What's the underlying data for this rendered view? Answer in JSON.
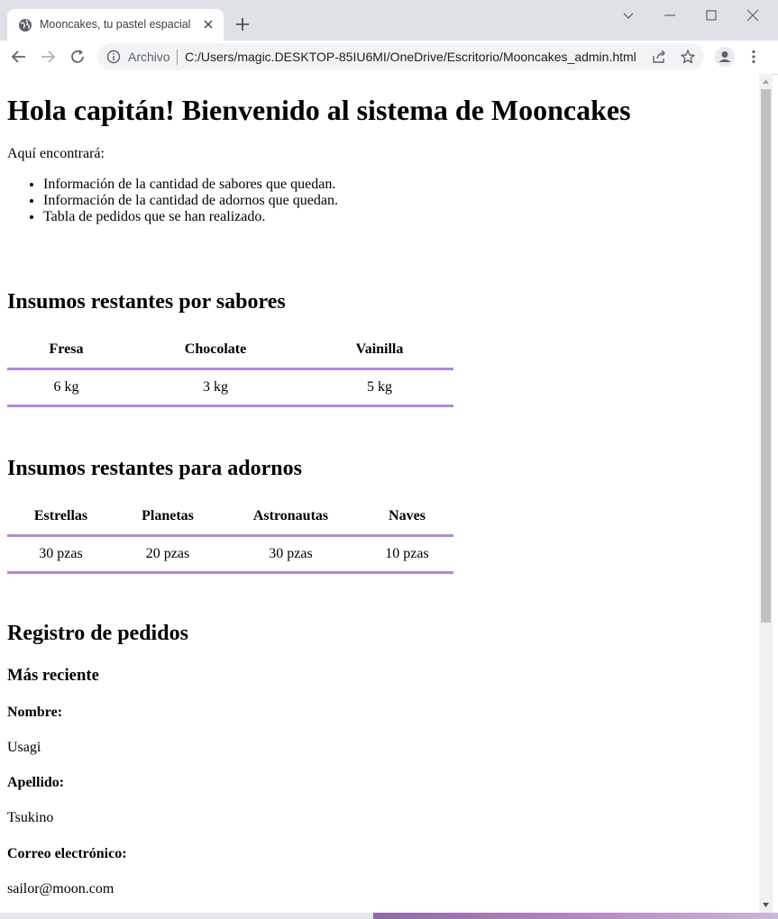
{
  "browser": {
    "tab_title": "Mooncakes, tu pastel espacial",
    "scheme_label": "Archivo",
    "url": "C:/Users/magic.DESKTOP-85IU6MI/OneDrive/Escritorio/Mooncakes_admin.html"
  },
  "page": {
    "title": "Hola capitán! Bienvenido al sistema de Mooncakes",
    "intro": "Aquí encontrará:",
    "features": [
      "Información de la cantidad de sabores que quedan.",
      "Información de la cantidad de adornos que quedan.",
      "Tabla de pedidos que se han realizado."
    ],
    "flavors": {
      "heading": "Insumos restantes por sabores",
      "headers": [
        "Fresa",
        "Chocolate",
        "Vainilla"
      ],
      "values": [
        "6 kg",
        "3 kg",
        "5 kg"
      ]
    },
    "decorations": {
      "heading": "Insumos restantes para adornos",
      "headers": [
        "Estrellas",
        "Planetas",
        "Astronautas",
        "Naves"
      ],
      "values": [
        "30 pzas",
        "20 pzas",
        "30 pzas",
        "10 pzas"
      ]
    },
    "orders": {
      "heading": "Registro de pedidos",
      "subheading": "Más reciente",
      "name_label": "Nombre:",
      "name_value": "Usagi",
      "surname_label": "Apellido:",
      "surname_value": "Tsukino",
      "email_label": "Correo electrónico:",
      "email_value": "sailor@moon.com"
    }
  },
  "colors": {
    "table_border": "#b38ad4",
    "tabstrip": "#dee1e6"
  }
}
